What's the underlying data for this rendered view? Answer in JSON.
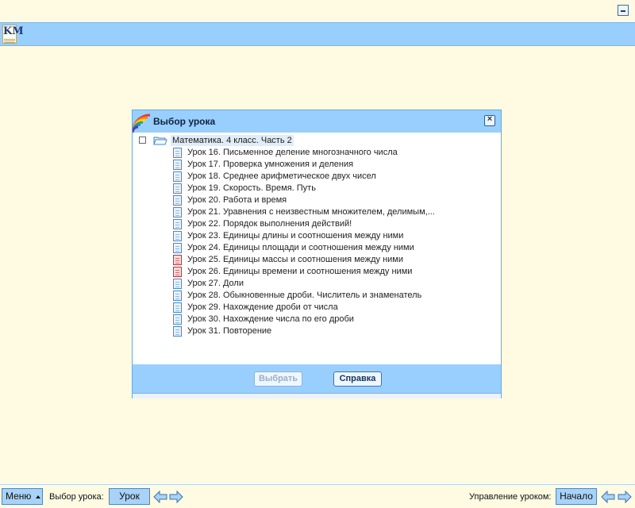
{
  "header": {
    "logo_letters": "KM",
    "minimize_icon": "minimize-icon"
  },
  "dialog": {
    "title": "Выбор урока",
    "close_icon": "close-icon",
    "root": "Математика. 4 класс. Часть 2",
    "items": [
      {
        "label": "Урок 16. Письменное деление многозначного числа",
        "icon": "doc-icon"
      },
      {
        "label": "Урок 17. Проверка умножения и деления",
        "icon": "doc-icon"
      },
      {
        "label": "Урок 18. Среднее арифметическое двух чисел",
        "icon": "doc-icon"
      },
      {
        "label": "Урок 19. Скорость. Время. Путь",
        "icon": "doc-icon"
      },
      {
        "label": "Урок 20. Работа и время",
        "icon": "doc-icon"
      },
      {
        "label": "Урок 21. Уравнения с неизвестным множителем, делимым,...",
        "icon": "doc-icon"
      },
      {
        "label": "Урок 22. Порядок выполнения действий!",
        "icon": "doc-icon"
      },
      {
        "label": "Урок 23. Единицы длины и соотношения между ними",
        "icon": "doc-icon"
      },
      {
        "label": "Урок 24. Единицы площади и соотношения между ними",
        "icon": "doc-icon"
      },
      {
        "label": "Урок 25. Единицы массы и соотношения между ними",
        "icon": "doc-red-icon"
      },
      {
        "label": "Урок 26. Единицы времени и соотношения между ними",
        "icon": "doc-red-icon"
      },
      {
        "label": "Урок 27. Доли",
        "icon": "doc-icon"
      },
      {
        "label": "Урок 28. Обыкновенные дроби. Числитель и знаменатель",
        "icon": "doc-icon"
      },
      {
        "label": "Урок 29. Нахождение дроби от числа",
        "icon": "doc-icon"
      },
      {
        "label": "Урок 30. Нахождение числа по его дроби",
        "icon": "doc-icon"
      },
      {
        "label": "Урок 31. Повторение",
        "icon": "doc-icon"
      }
    ],
    "select_button": "Выбрать",
    "help_button": "Справка"
  },
  "bottom": {
    "menu": "Меню",
    "lesson_choice_label": "Выбор урока:",
    "lesson_button": "Урок",
    "lesson_control_label": "Управление уроком:",
    "start_button": "Начало"
  },
  "colors": {
    "background": "#fefbe2",
    "bar_blue": "#99cfff",
    "button_blue": "#a8d2f7",
    "red_icon": "#c0303a"
  }
}
